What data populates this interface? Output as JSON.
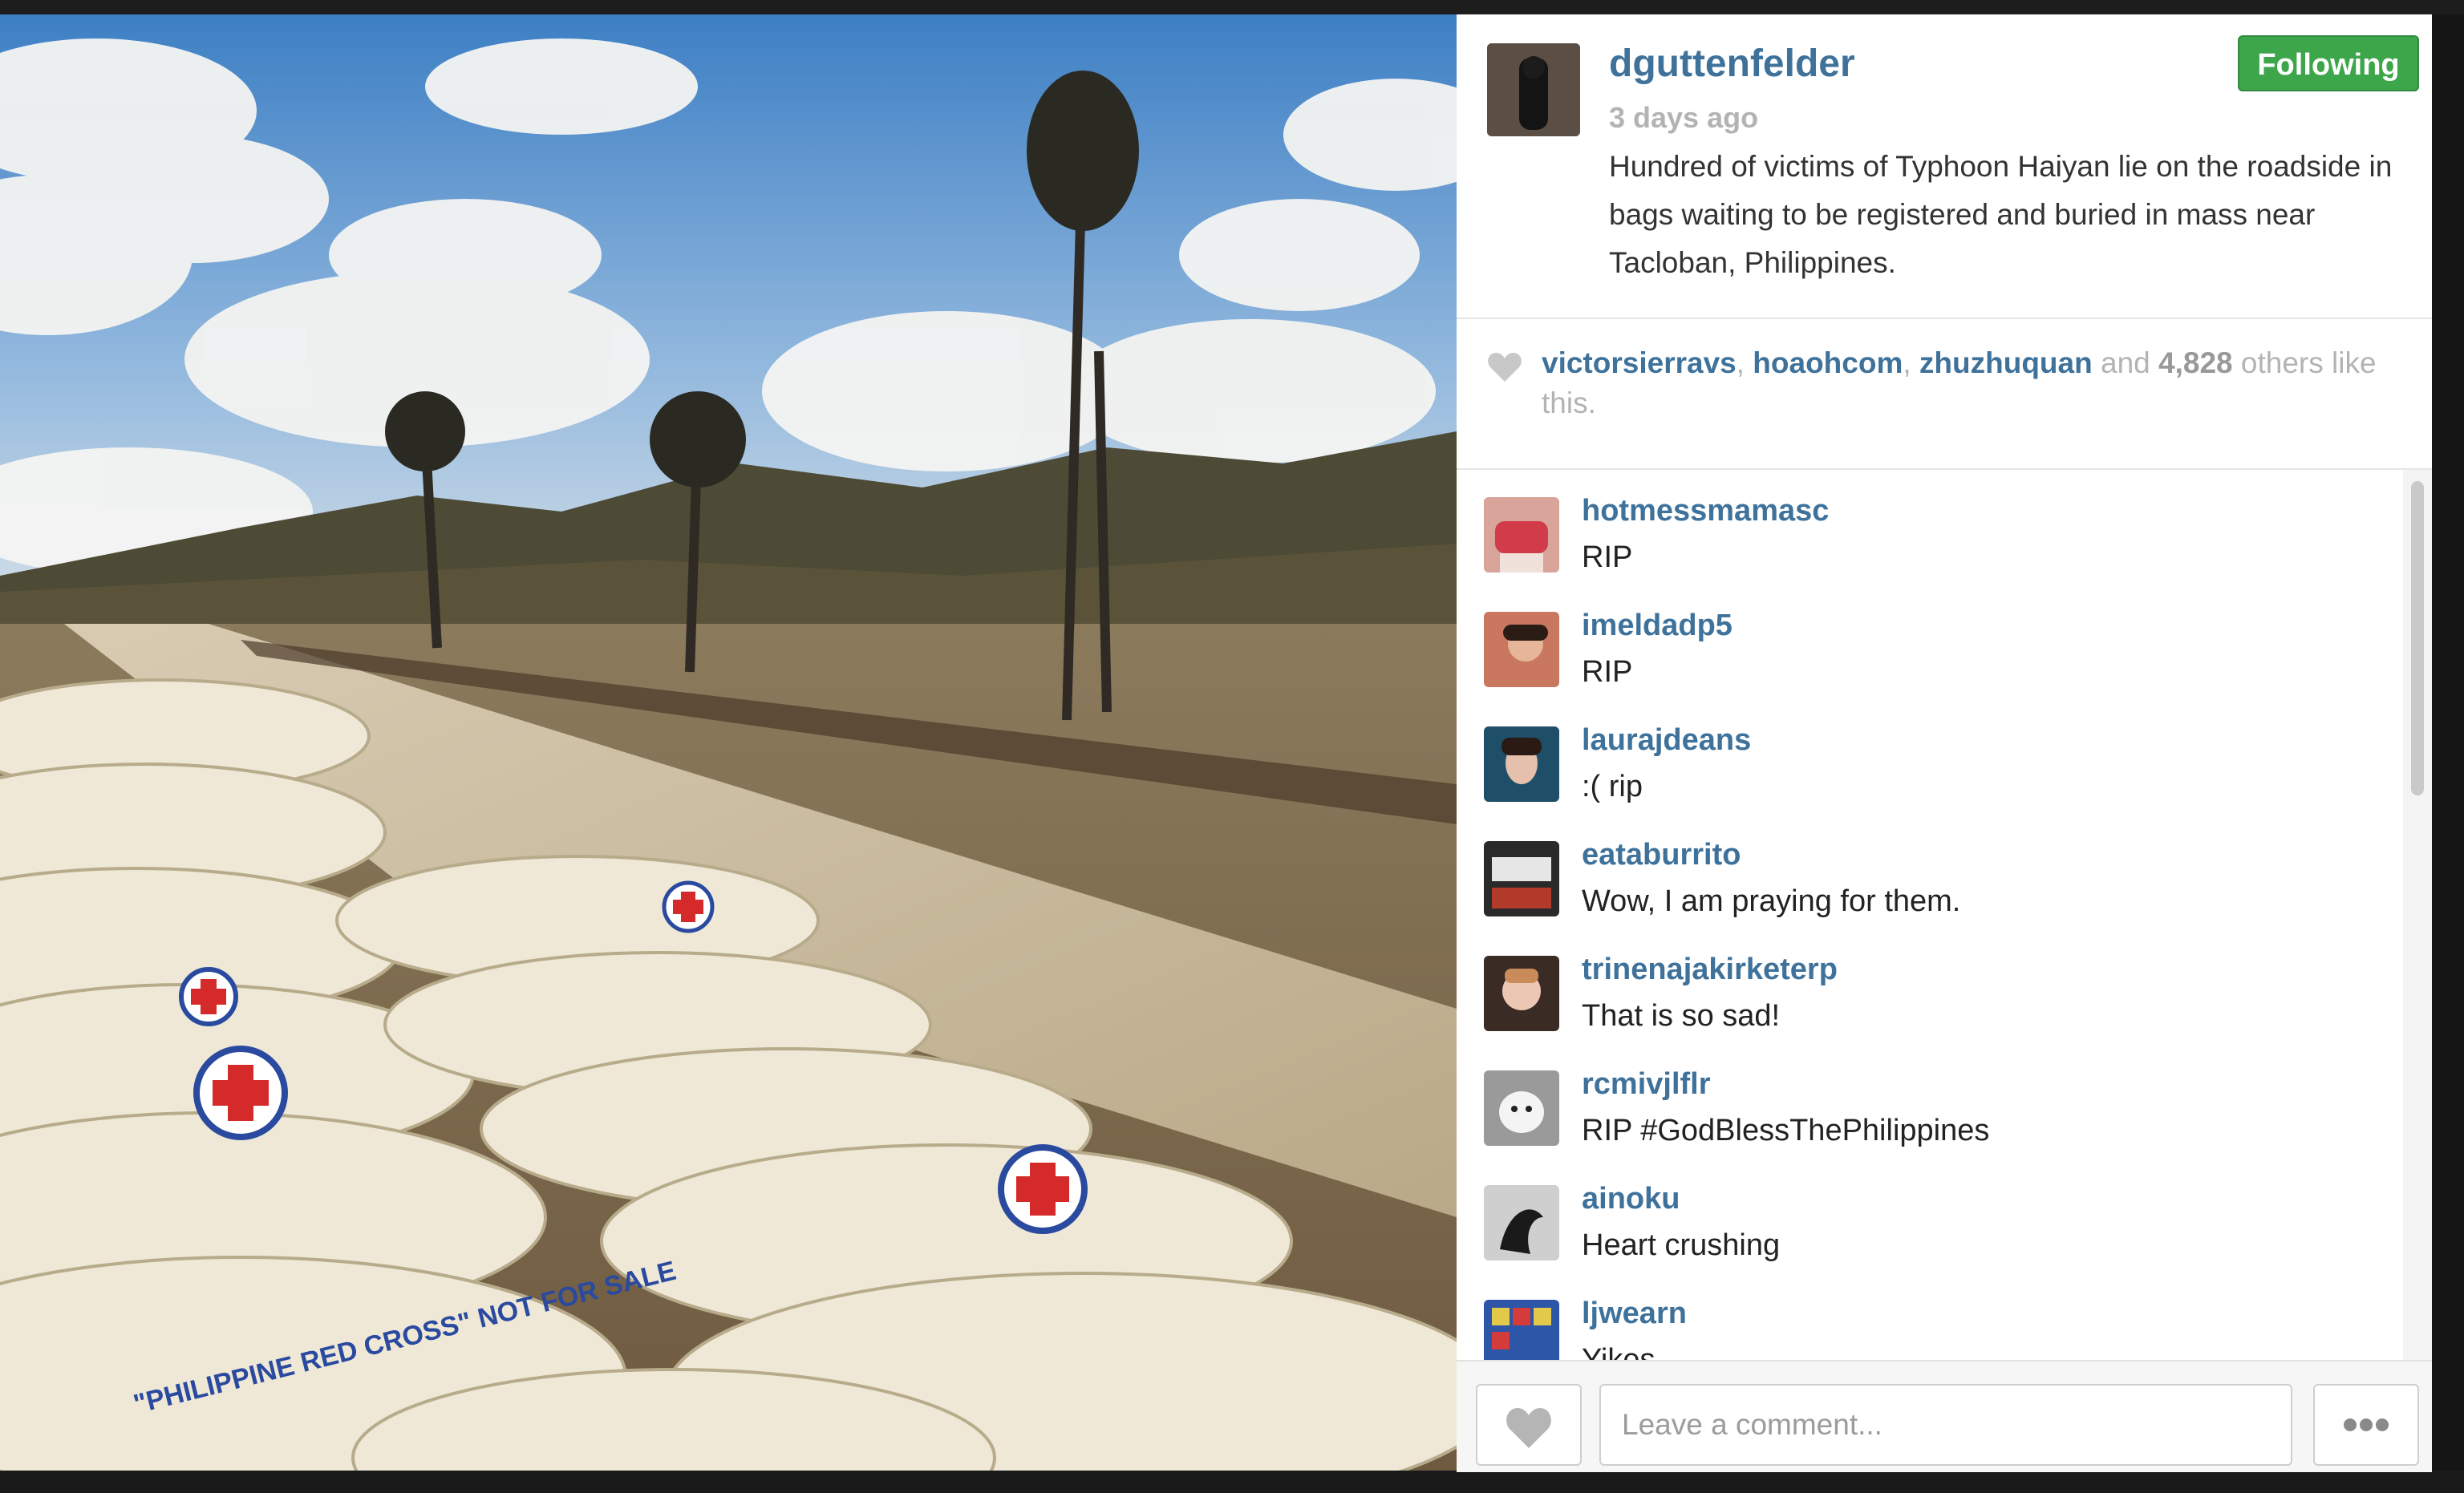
{
  "post": {
    "username": "dguttenfelder",
    "time_ago": "3 days ago",
    "follow_label": "Following",
    "caption": "Hundred of victims of Typhoon Haiyan lie on the roadside in bags waiting to be registered and buried in mass near Tacloban, Philippines.",
    "photo_icon": "photo-image",
    "bag_label": "\"PHILIPPINE RED CROSS\" NOT FOR SALE"
  },
  "likes": {
    "users": [
      "victorsierravs",
      "hoaohcom",
      "zhuzhuquan"
    ],
    "sep": ", ",
    "and": "and",
    "count": "4,828",
    "suffix": "others like this."
  },
  "comments": [
    {
      "user": "hotmessmamasc",
      "text": "RIP"
    },
    {
      "user": "imeldadp5",
      "text": "RIP"
    },
    {
      "user": "laurajdeans",
      "text": ":( rip"
    },
    {
      "user": "eataburrito",
      "text": "Wow, I am praying for them."
    },
    {
      "user": "trinenajakirketerp",
      "text": "That is so sad!"
    },
    {
      "user": "rcmivjlflr",
      "text": " RIP  #GodBlessThePhilippines"
    },
    {
      "user": "ainoku",
      "text": "Heart crushing"
    },
    {
      "user": "ljwearn",
      "text": "Yikes"
    }
  ],
  "footer": {
    "comment_placeholder": "Leave a comment..."
  },
  "colors": {
    "link": "#3f729b",
    "follow": "#3da64a",
    "muted": "#b3b3b3"
  }
}
